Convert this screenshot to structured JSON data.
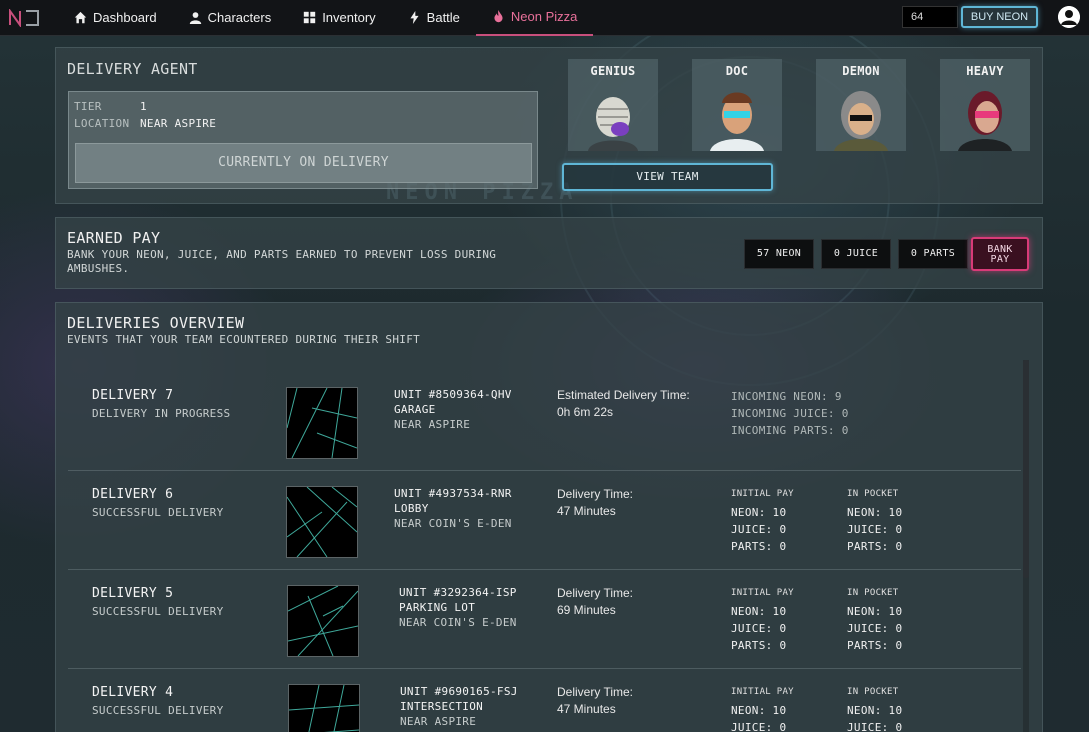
{
  "nav": {
    "items": [
      {
        "label": "Dashboard",
        "icon": "home-icon"
      },
      {
        "label": "Characters",
        "icon": "person-icon"
      },
      {
        "label": "Inventory",
        "icon": "grid-icon"
      },
      {
        "label": "Battle",
        "icon": "bolt-icon"
      },
      {
        "label": "Neon Pizza",
        "icon": "flame-icon",
        "active": true
      }
    ],
    "neon_balance": "64",
    "buy_label": "BUY NEON"
  },
  "agent": {
    "title": "DELIVERY AGENT",
    "tier_label": "TIER",
    "tier_value": "1",
    "location_label": "LOCATION",
    "location_value": "NEAR ASPIRE",
    "status_button": "CURRENTLY ON DELIVERY",
    "team": [
      {
        "name": "GENIUS"
      },
      {
        "name": "DOC"
      },
      {
        "name": "DEMON"
      },
      {
        "name": "HEAVY"
      }
    ],
    "view_team_label": "VIEW TEAM",
    "background_text": "NEON PIZZA"
  },
  "earned_pay": {
    "title": "EARNED PAY",
    "description": "BANK YOUR NEON, JUICE, AND PARTS EARNED TO PREVENT LOSS DURING AMBUSHES.",
    "neon": "57 NEON",
    "juice": "0 JUICE",
    "parts": "0 PARTS",
    "bank_label_1": "BANK",
    "bank_label_2": "PAY"
  },
  "overview": {
    "title": "DELIVERIES OVERVIEW",
    "subtitle": "EVENTS THAT YOUR TEAM ECOUNTERED DURING THEIR SHIFT",
    "deliveries": [
      {
        "title": "DELIVERY 7",
        "status": "DELIVERY IN PROGRESS",
        "unit": "UNIT #8509364-QHV",
        "place": "GARAGE",
        "near": "NEAR ASPIRE",
        "time_label": "Estimated Delivery Time:",
        "time_value": "0h 6m 22s",
        "incoming_neon": "INCOMING NEON: 9",
        "incoming_juice": "INCOMING JUICE: 0",
        "incoming_parts": "INCOMING PARTS: 0"
      },
      {
        "title": "DELIVERY 6",
        "status": "SUCCESSFUL DELIVERY",
        "unit": "UNIT #4937534-RNR",
        "place": "LOBBY",
        "near": "NEAR COIN'S E-DEN",
        "time_label": "Delivery Time:",
        "time_value": "47 Minutes",
        "initial_header": "INITIAL PAY",
        "initial": [
          "NEON: 10",
          "JUICE: 0",
          "PARTS: 0"
        ],
        "pocket_header": "IN POCKET",
        "pocket": [
          "NEON: 10",
          "JUICE: 0",
          "PARTS: 0"
        ]
      },
      {
        "title": "DELIVERY 5",
        "status": "SUCCESSFUL DELIVERY",
        "unit": "UNIT #3292364-ISP",
        "place": "PARKING LOT",
        "near": "NEAR COIN'S E-DEN",
        "time_label": "Delivery Time:",
        "time_value": "69 Minutes",
        "initial_header": "INITIAL PAY",
        "initial": [
          "NEON: 10",
          "JUICE: 0",
          "PARTS: 0"
        ],
        "pocket_header": "IN POCKET",
        "pocket": [
          "NEON: 10",
          "JUICE: 0",
          "PARTS: 0"
        ]
      },
      {
        "title": "DELIVERY 4",
        "status": "SUCCESSFUL DELIVERY",
        "unit": "UNIT #9690165-FSJ",
        "place": "INTERSECTION",
        "near": "NEAR ASPIRE",
        "time_label": "Delivery Time:",
        "time_value": "47 Minutes",
        "initial_header": "INITIAL PAY",
        "initial": [
          "NEON: 10",
          "JUICE: 0"
        ],
        "pocket_header": "IN POCKET",
        "pocket": [
          "NEON: 10",
          "JUICE: 0"
        ]
      }
    ]
  },
  "colors": {
    "accent_cyan": "#5fb6d6",
    "accent_pink": "#d83b78",
    "active_nav": "#e8709a"
  }
}
